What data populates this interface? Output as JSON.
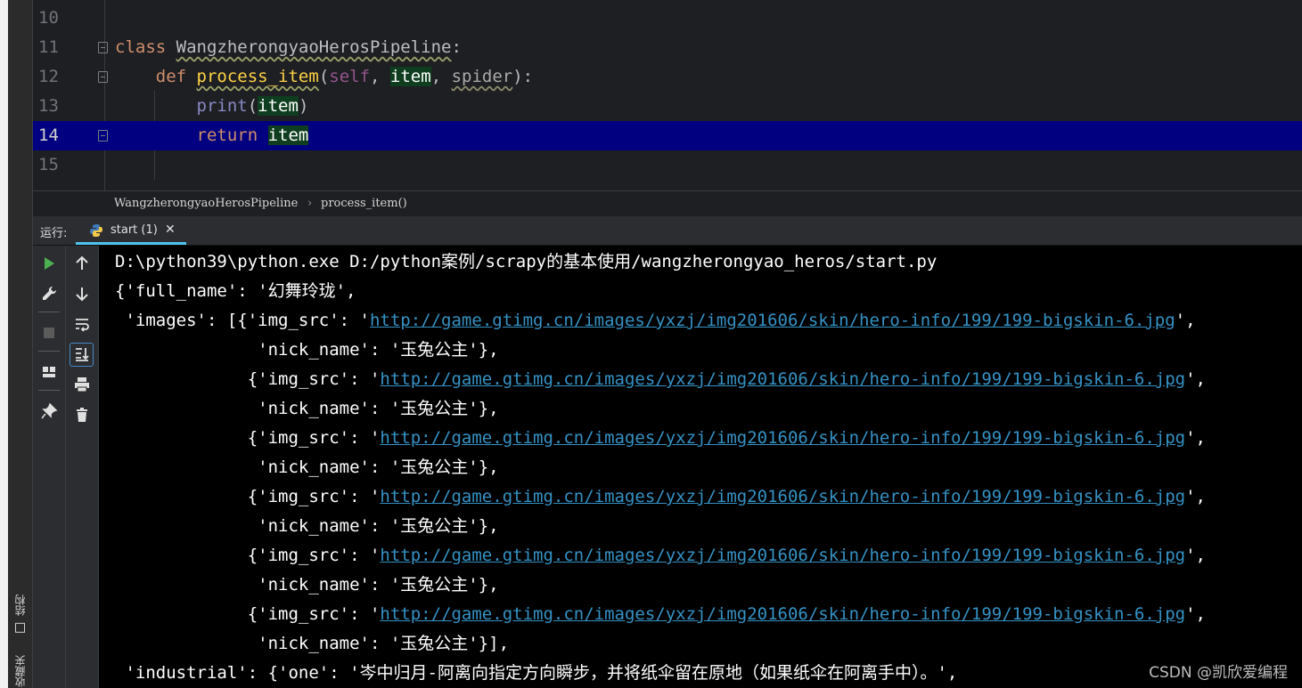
{
  "left_strip": {
    "structure_label": "结构",
    "bookmarks_label": "收藏夹"
  },
  "editor": {
    "lines": [
      {
        "no": "10"
      },
      {
        "no": "11",
        "kw": "class ",
        "name": "WangzherongyaoHerosPipeline",
        "rest": ":"
      },
      {
        "no": "12",
        "indent": "    ",
        "kw": "def ",
        "name": "process_item",
        "p1": "(",
        "self": "self",
        "c1": ", ",
        "item": "item",
        "c2": ", ",
        "spider": "spider",
        "rest": "):"
      },
      {
        "no": "13",
        "indent": "        ",
        "builtin": "print",
        "p1": "(",
        "item": "item",
        "rest": ")"
      },
      {
        "no": "14",
        "indent": "        ",
        "kw": "return ",
        "item": "item"
      },
      {
        "no": "15"
      }
    ]
  },
  "breadcrumb": {
    "class_name": "WangzherongyaoHerosPipeline",
    "separator": "›",
    "method": "process_item()"
  },
  "run_panel": {
    "label": "运行:",
    "tab_label": "start (1)",
    "tab_close": "✕"
  },
  "toolbar_icons": [
    "run-icon",
    "wrench-icon",
    "stop-icon",
    "layout-icon",
    "pin-icon",
    "up-arrow-icon",
    "down-arrow-icon",
    "soft-wrap-icon",
    "scroll-to-end-icon",
    "print-icon",
    "trash-icon"
  ],
  "console": {
    "command": "D:\\python39\\python.exe D:/python案例/scrapy的基本使用/wangzherongyao_heros/start.py",
    "line1": "{'full_name': '幻舞玲珑',",
    "images_prefix": " 'images': [{'img_src': '",
    "img_prefix": "             {'img_src': '",
    "url": "http://game.gtimg.cn/images/yxzj/img201606/skin/hero-info/199/199-bigskin-6.jpg",
    "url_suffix": "',",
    "nick_line": "              'nick_name': '玉兔公主'},",
    "nick_line_last": "              'nick_name': '玉兔公主'}],",
    "industrial": " 'industrial': {'one': '岑中归月-阿离向指定方向瞬步，并将纸伞留在原地（如果纸伞在阿离手中）。',"
  },
  "watermark": "CSDN @凯欣爱编程",
  "colors": {
    "background": "#1e1f22",
    "console_bg": "#000000",
    "current_line": "#000080",
    "link": "#3592c4",
    "keyword": "#cf8e6d",
    "tab_underline": "#4dc5ee"
  }
}
